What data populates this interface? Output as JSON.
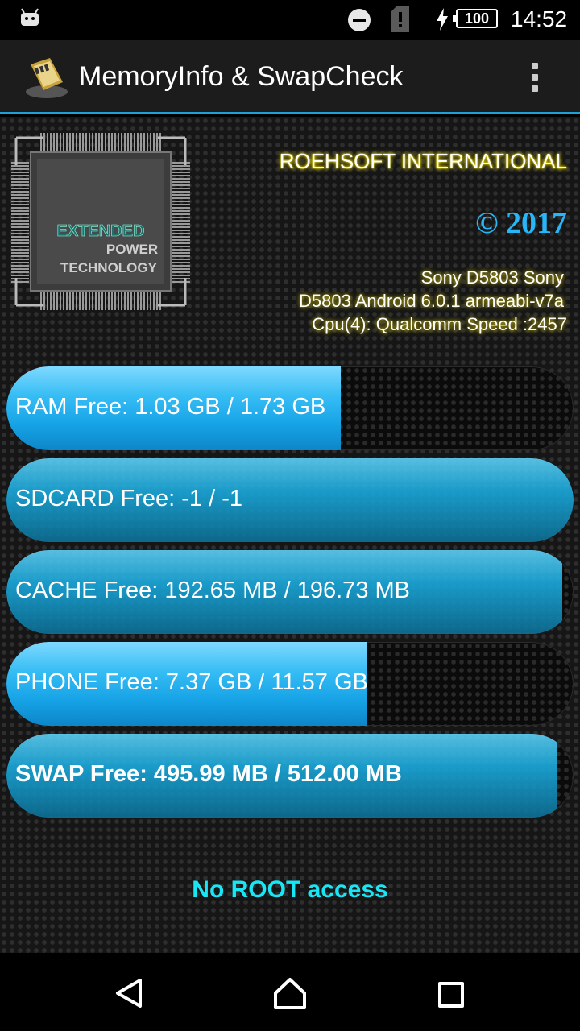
{
  "status_bar": {
    "battery_level": "100",
    "time": "14:52"
  },
  "app_bar": {
    "title": "MemoryInfo & SwapCheck"
  },
  "chip": {
    "line1": "EXTENDED",
    "line2": "POWER",
    "line3": "TECHNOLOGY"
  },
  "header": {
    "brand": "ROEHSOFT INTERNATIONAL",
    "copyright": "© 2017",
    "device_line1": "Sony D5803 Sony",
    "device_line2": "D5803 Android 6.0.1 armeabi-v7a",
    "device_line3": "Cpu(4): Qualcomm Speed :2457"
  },
  "memory_bars": [
    {
      "label": "RAM  Free: 1.03 GB / 1.73 GB",
      "fill_fraction": 0.59
    },
    {
      "label": "SDCARD Free: -1 / -1",
      "fill_fraction": 1.0
    },
    {
      "label": "CACHE Free: 192.65 MB / 196.73 MB",
      "fill_fraction": 0.98
    },
    {
      "label": "PHONE Free: 7.37 GB / 11.57 GB",
      "fill_fraction": 0.635
    },
    {
      "label": "SWAP  Free: 495.99 MB / 512.00 MB",
      "fill_fraction": 0.97
    }
  ],
  "root_status": "No ROOT access",
  "colors": {
    "accent": "#1ea0d8",
    "bar_fill": "#29b6f6",
    "root_text": "#18e6f5",
    "glow": "#ffea00"
  },
  "icons": {
    "status": [
      "android-icon",
      "do-not-disturb-icon",
      "no-sim-icon",
      "charging-bolt-icon",
      "battery-icon"
    ],
    "app_bar": [
      "sd-card-app-icon",
      "overflow-menu-icon"
    ],
    "nav": [
      "back-icon",
      "home-icon",
      "recents-icon"
    ]
  }
}
